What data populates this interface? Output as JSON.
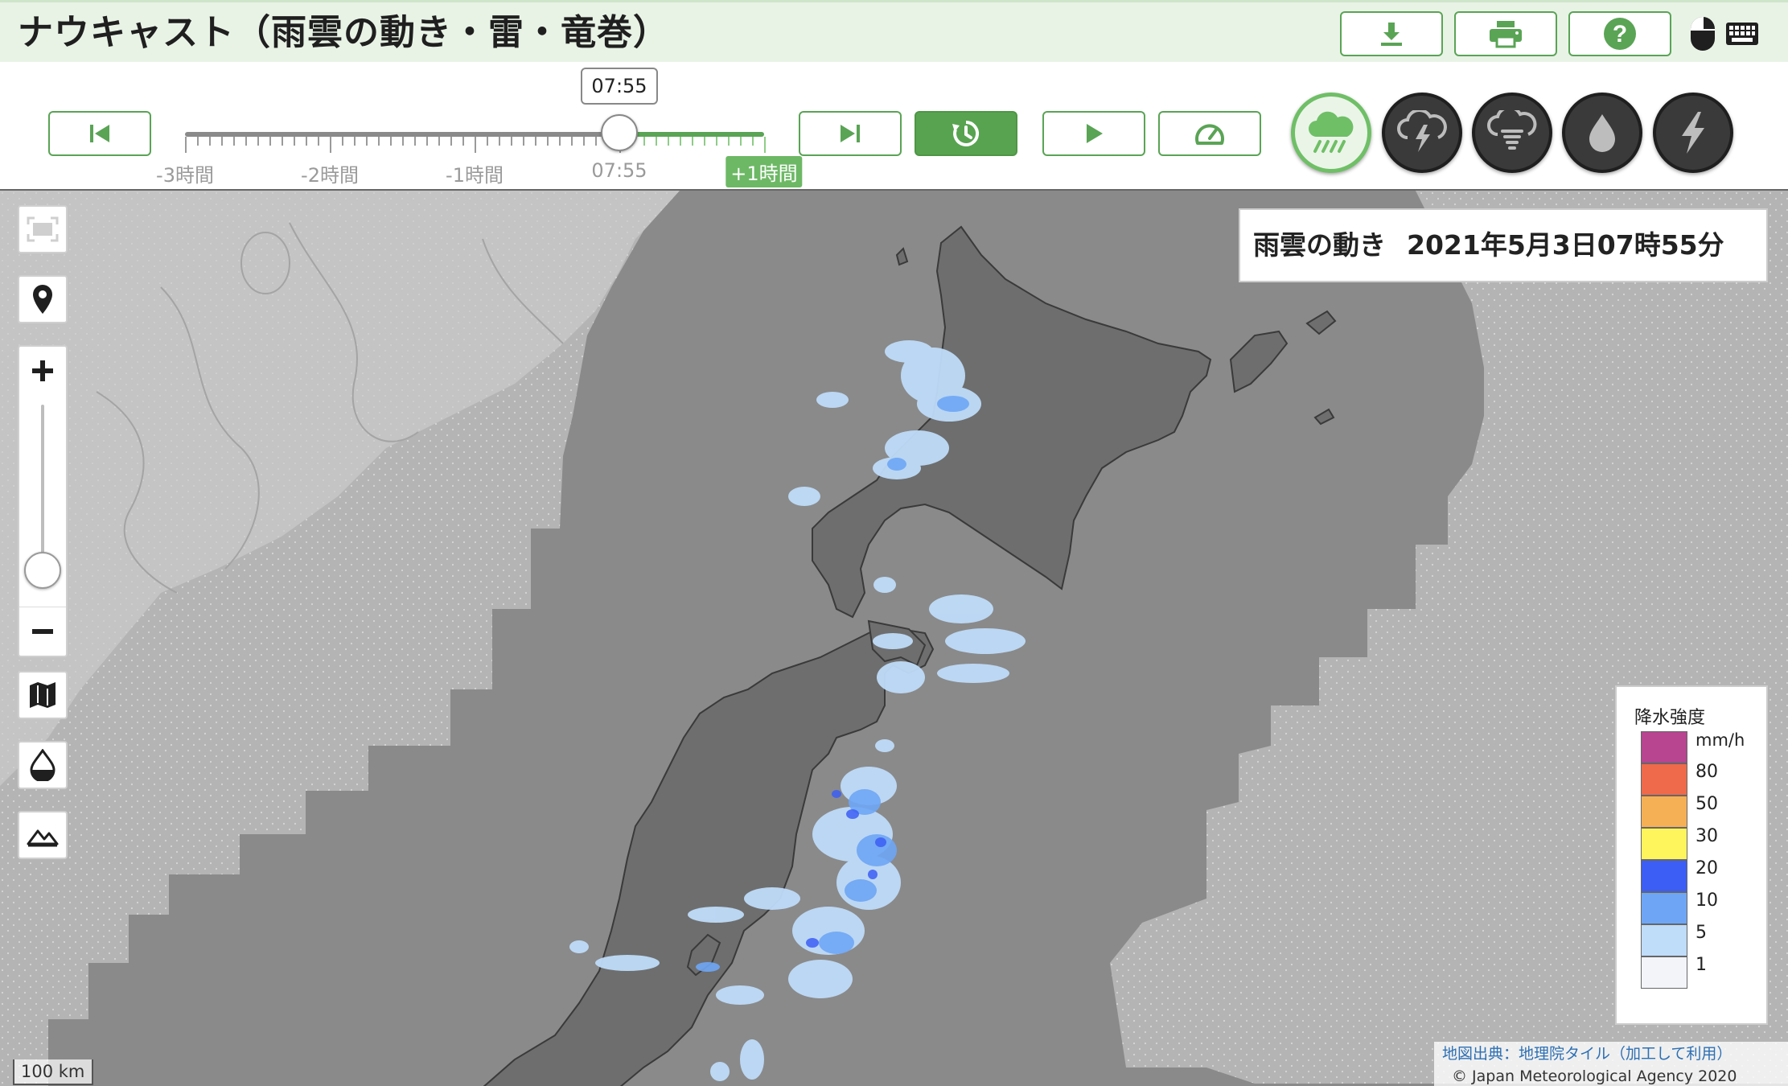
{
  "header": {
    "title": "ナウキャスト（雨雲の動き・雷・竜巻）",
    "buttons": [
      {
        "name": "download",
        "icon": "download-icon"
      },
      {
        "name": "print",
        "icon": "print-icon"
      },
      {
        "name": "help",
        "icon": "help-icon"
      }
    ],
    "indicators": [
      "mouse-icon",
      "keyboard-icon"
    ]
  },
  "timeline": {
    "current_time": "07:55",
    "labels": [
      "-3時間",
      "-2時間",
      "-1時間",
      "07:55",
      "+1時間"
    ],
    "current_fraction": 0.75,
    "controls": [
      "first-frame-icon",
      "last-frame-icon",
      "latest-icon",
      "play-icon",
      "speed-icon"
    ]
  },
  "layers": [
    {
      "name": "rain-cloud",
      "icon": "rain-cloud-icon",
      "active": true
    },
    {
      "name": "thunder",
      "icon": "thunder-cloud-icon",
      "active": false
    },
    {
      "name": "tornado",
      "icon": "tornado-cloud-icon",
      "active": false
    },
    {
      "name": "drop",
      "icon": "drop-icon",
      "active": false
    },
    {
      "name": "lightning",
      "icon": "lightning-icon",
      "active": false
    }
  ],
  "map": {
    "datetime_label": "雨雲の動き",
    "datetime_value": "2021年5月3日07時55分",
    "zoom_level_fraction": 0.85,
    "legend": {
      "title": "降水強度",
      "unit": "mm/h",
      "levels": [
        {
          "label": "",
          "color": "#b7458f"
        },
        {
          "label": "80",
          "color": "#ef6a4a"
        },
        {
          "label": "50",
          "color": "#f5b056"
        },
        {
          "label": "30",
          "color": "#fef55d"
        },
        {
          "label": "20",
          "color": "#3c5ef5"
        },
        {
          "label": "10",
          "color": "#6ea6f5"
        },
        {
          "label": "5",
          "color": "#bfdcf9"
        },
        {
          "label": "1",
          "color": "#f3f4fa"
        }
      ]
    },
    "scale": "100 km",
    "attribution_source": "地図出典：地理院タイル（加工して利用）",
    "attribution_copyright": "© Japan Meteorological Agency 2020",
    "colors": {
      "accent": "#5aa455",
      "map_sea": "#8a8a8a",
      "map_outside": "#b9b9b9",
      "land": "#6e6e6e"
    }
  }
}
